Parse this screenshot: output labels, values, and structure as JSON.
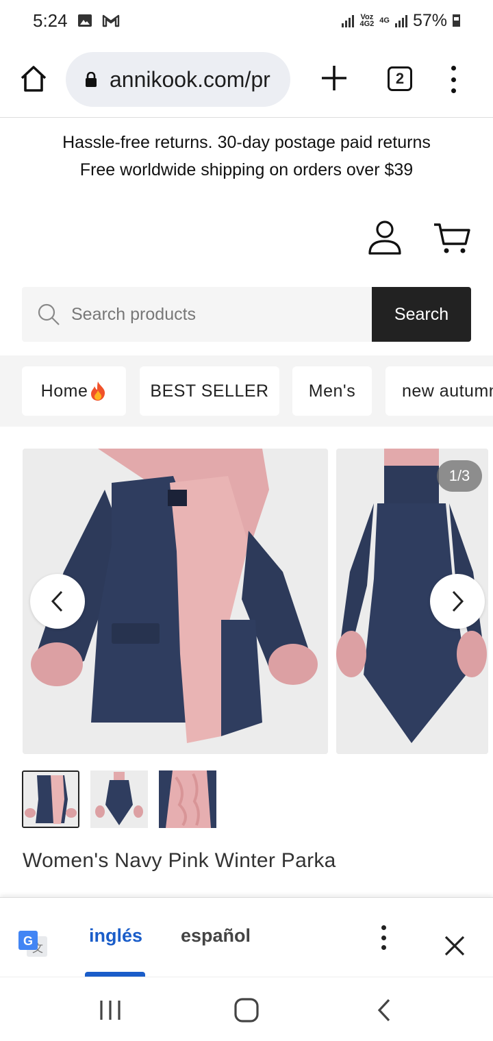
{
  "status_bar": {
    "time": "5:24",
    "network_top": "Voz",
    "network_bottom": "4G2",
    "network_tech": "4G",
    "battery": "57%"
  },
  "browser": {
    "url": "annikook.com/pr",
    "tab_count": "2"
  },
  "announcement": {
    "line1": "Hassle-free returns. 30-day postage paid returns",
    "line2": "Free worldwide shipping on orders over $39"
  },
  "search": {
    "placeholder": "Search products",
    "button_label": "Search"
  },
  "nav_chips": [
    {
      "label": "Home"
    },
    {
      "label": "BEST SELLER"
    },
    {
      "label": "Men's"
    },
    {
      "label": "new autumn"
    }
  ],
  "gallery": {
    "counter": "1/3"
  },
  "product": {
    "title": "Women's Navy Pink Winter Parka"
  },
  "translate_bar": {
    "source_lang": "inglés",
    "target_lang": "español"
  },
  "colors": {
    "navy": "#2d3a5a",
    "pink_fur": "#e8b3b3",
    "accent_blue": "#1a5dc9"
  }
}
